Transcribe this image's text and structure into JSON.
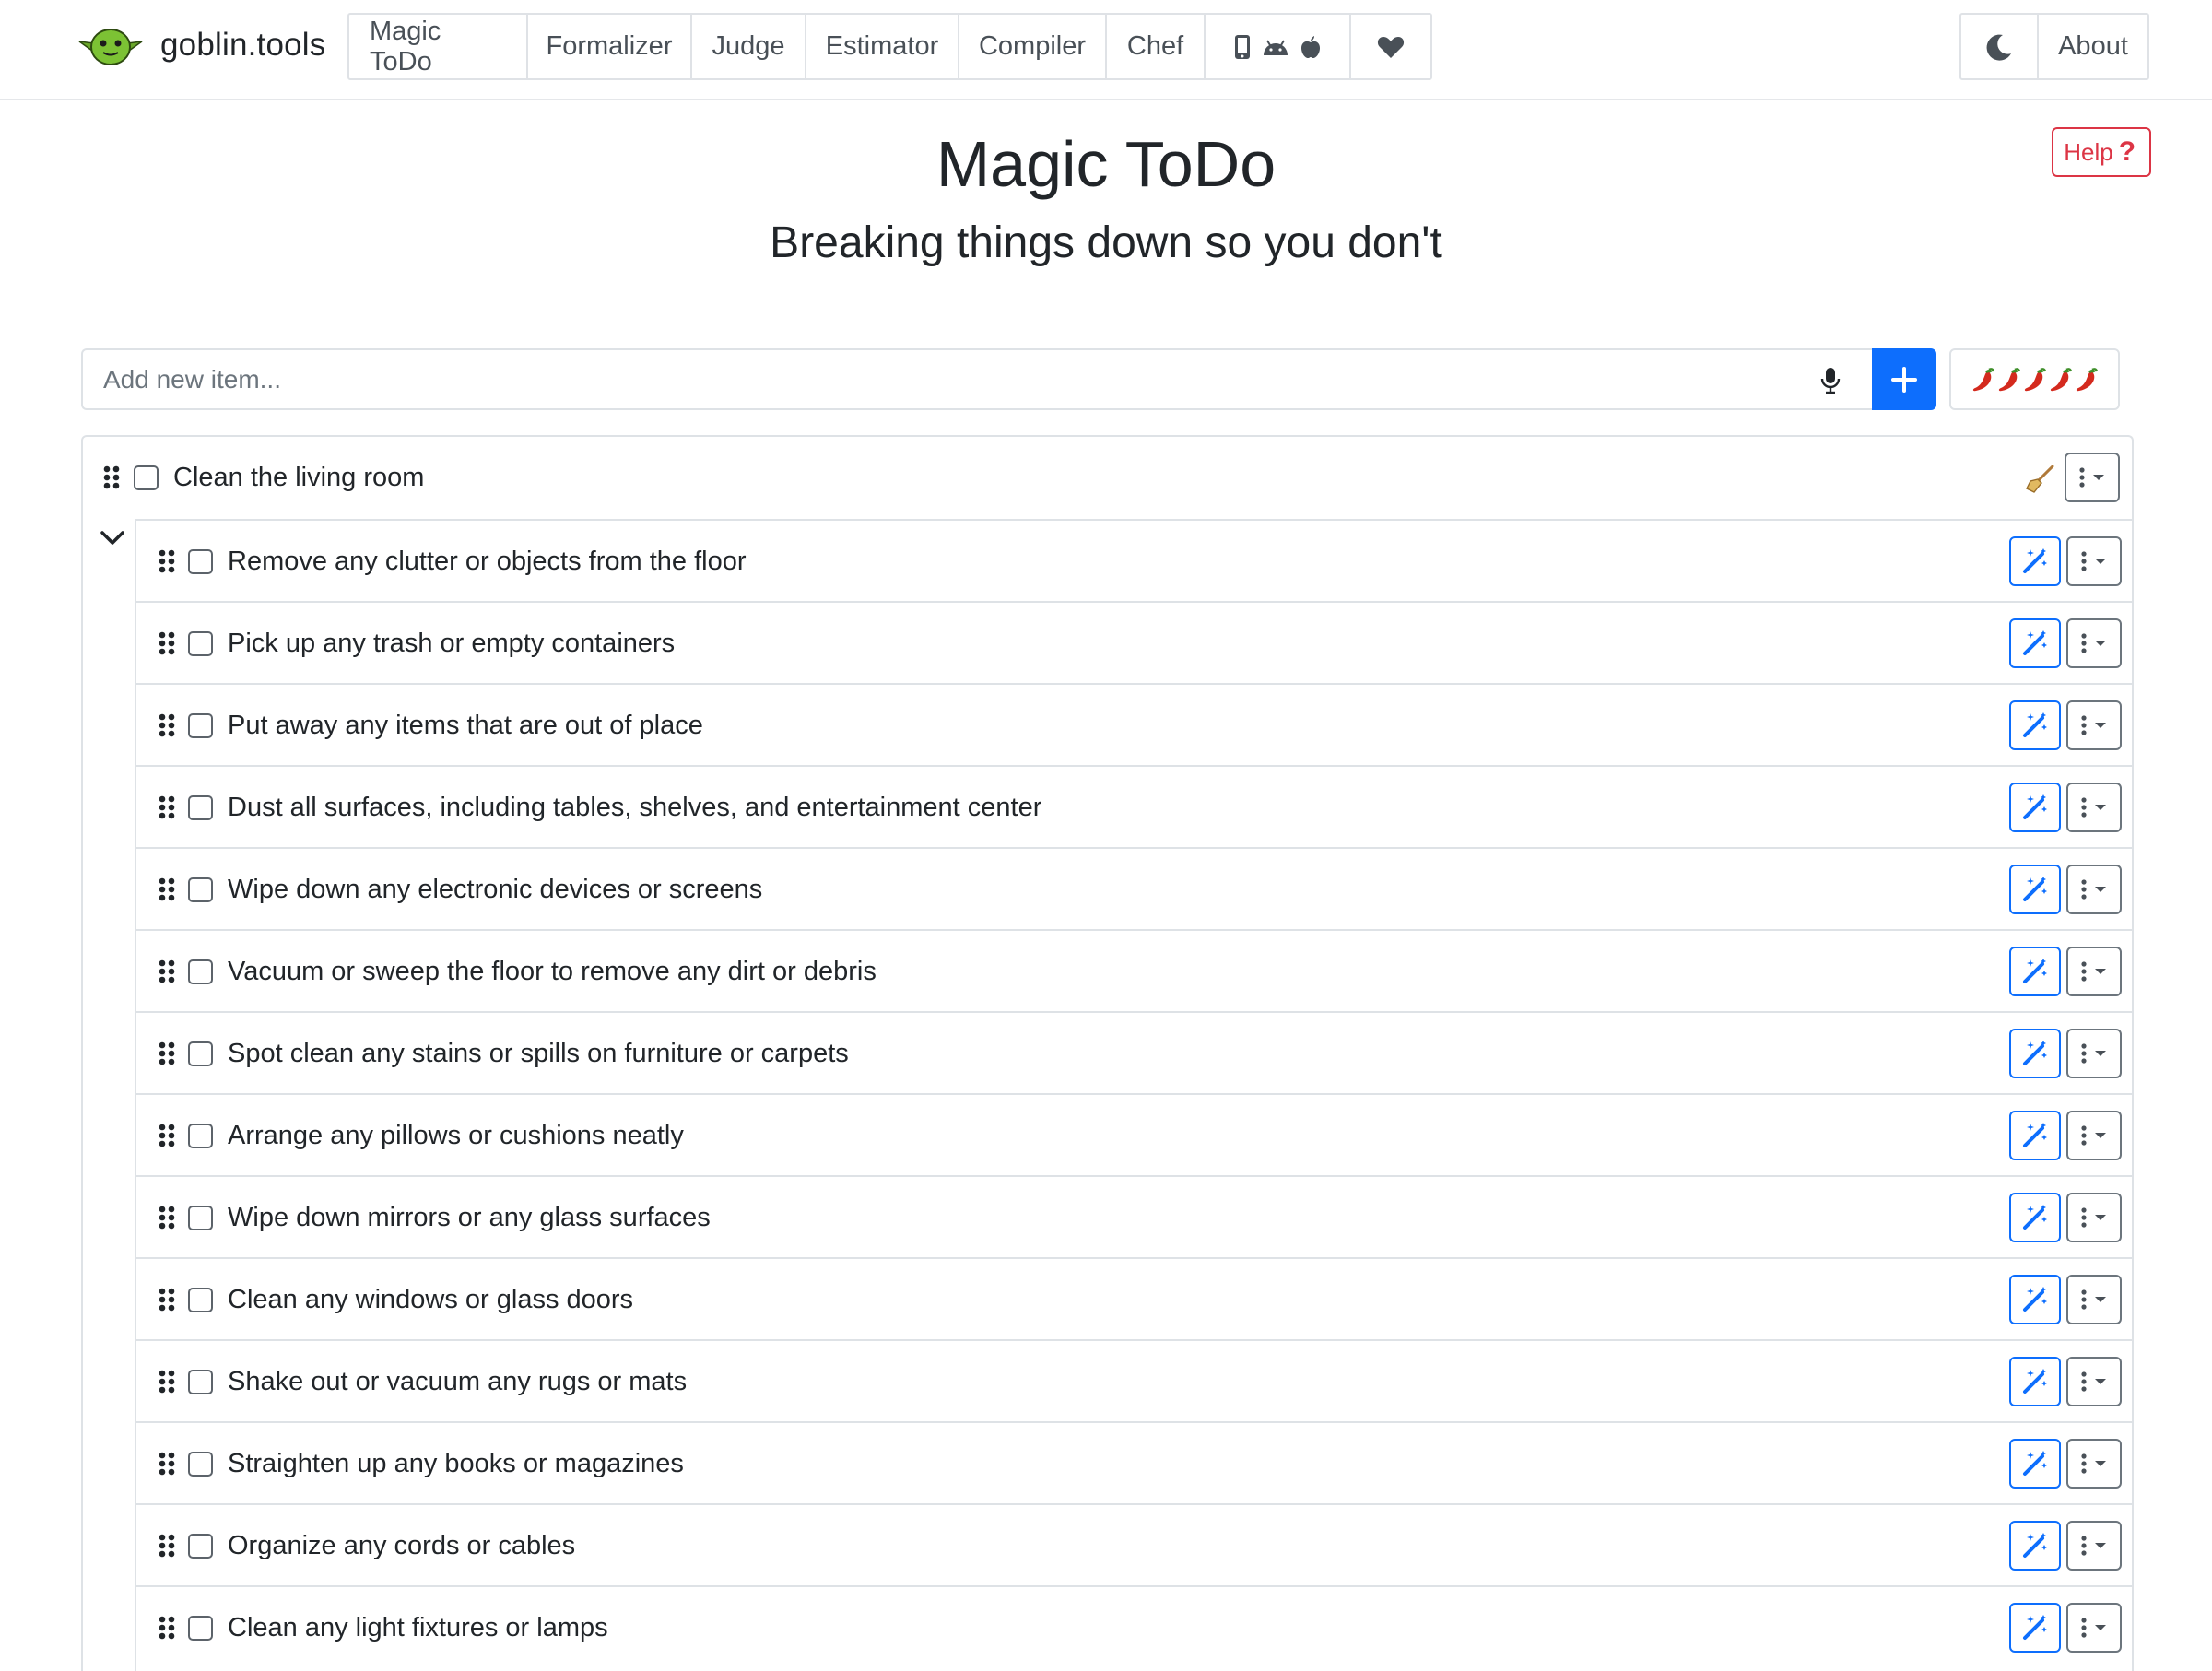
{
  "brand": {
    "name": "goblin.tools",
    "logo_icon": "goblin-logo-icon"
  },
  "nav": {
    "items": [
      "Magic ToDo",
      "Formalizer",
      "Judge",
      "Estimator",
      "Compiler",
      "Chef"
    ],
    "platform_icons": [
      "phone-icon",
      "android-icon",
      "apple-icon"
    ],
    "support_icon": "heart-icon",
    "dark_mode_icon": "moon-icon",
    "about": "About"
  },
  "header": {
    "title": "Magic ToDo",
    "subtitle": "Breaking things down so you don't",
    "help_label": "Help"
  },
  "add_bar": {
    "placeholder": "Add new item...",
    "mic_icon": "microphone-icon",
    "add_icon": "plus-icon",
    "spiciness_icon": "chili-pepper-icon",
    "spiciness_level": 5
  },
  "tasks": {
    "parent": {
      "label": "Clean the living room",
      "checked": false,
      "expanded": true,
      "status_icon": "broom-icon"
    },
    "subtasks": [
      "Remove any clutter or objects from the floor",
      "Pick up any trash or empty containers",
      "Put away any items that are out of place",
      "Dust all surfaces, including tables, shelves, and entertainment center",
      "Wipe down any electronic devices or screens",
      "Vacuum or sweep the floor to remove any dirt or debris",
      "Spot clean any stains or spills on furniture or carpets",
      "Arrange any pillows or cushions neatly",
      "Wipe down mirrors or any glass surfaces",
      "Clean any windows or glass doors",
      "Shake out or vacuum any rugs or mats",
      "Straighten up any books or magazines",
      "Organize any cords or cables",
      "Clean any light fixtures or lamps"
    ]
  },
  "colors": {
    "primary": "#0d6efd",
    "danger": "#dc3545",
    "border": "#dee2e6",
    "text": "#212529",
    "muted": "#495057"
  }
}
